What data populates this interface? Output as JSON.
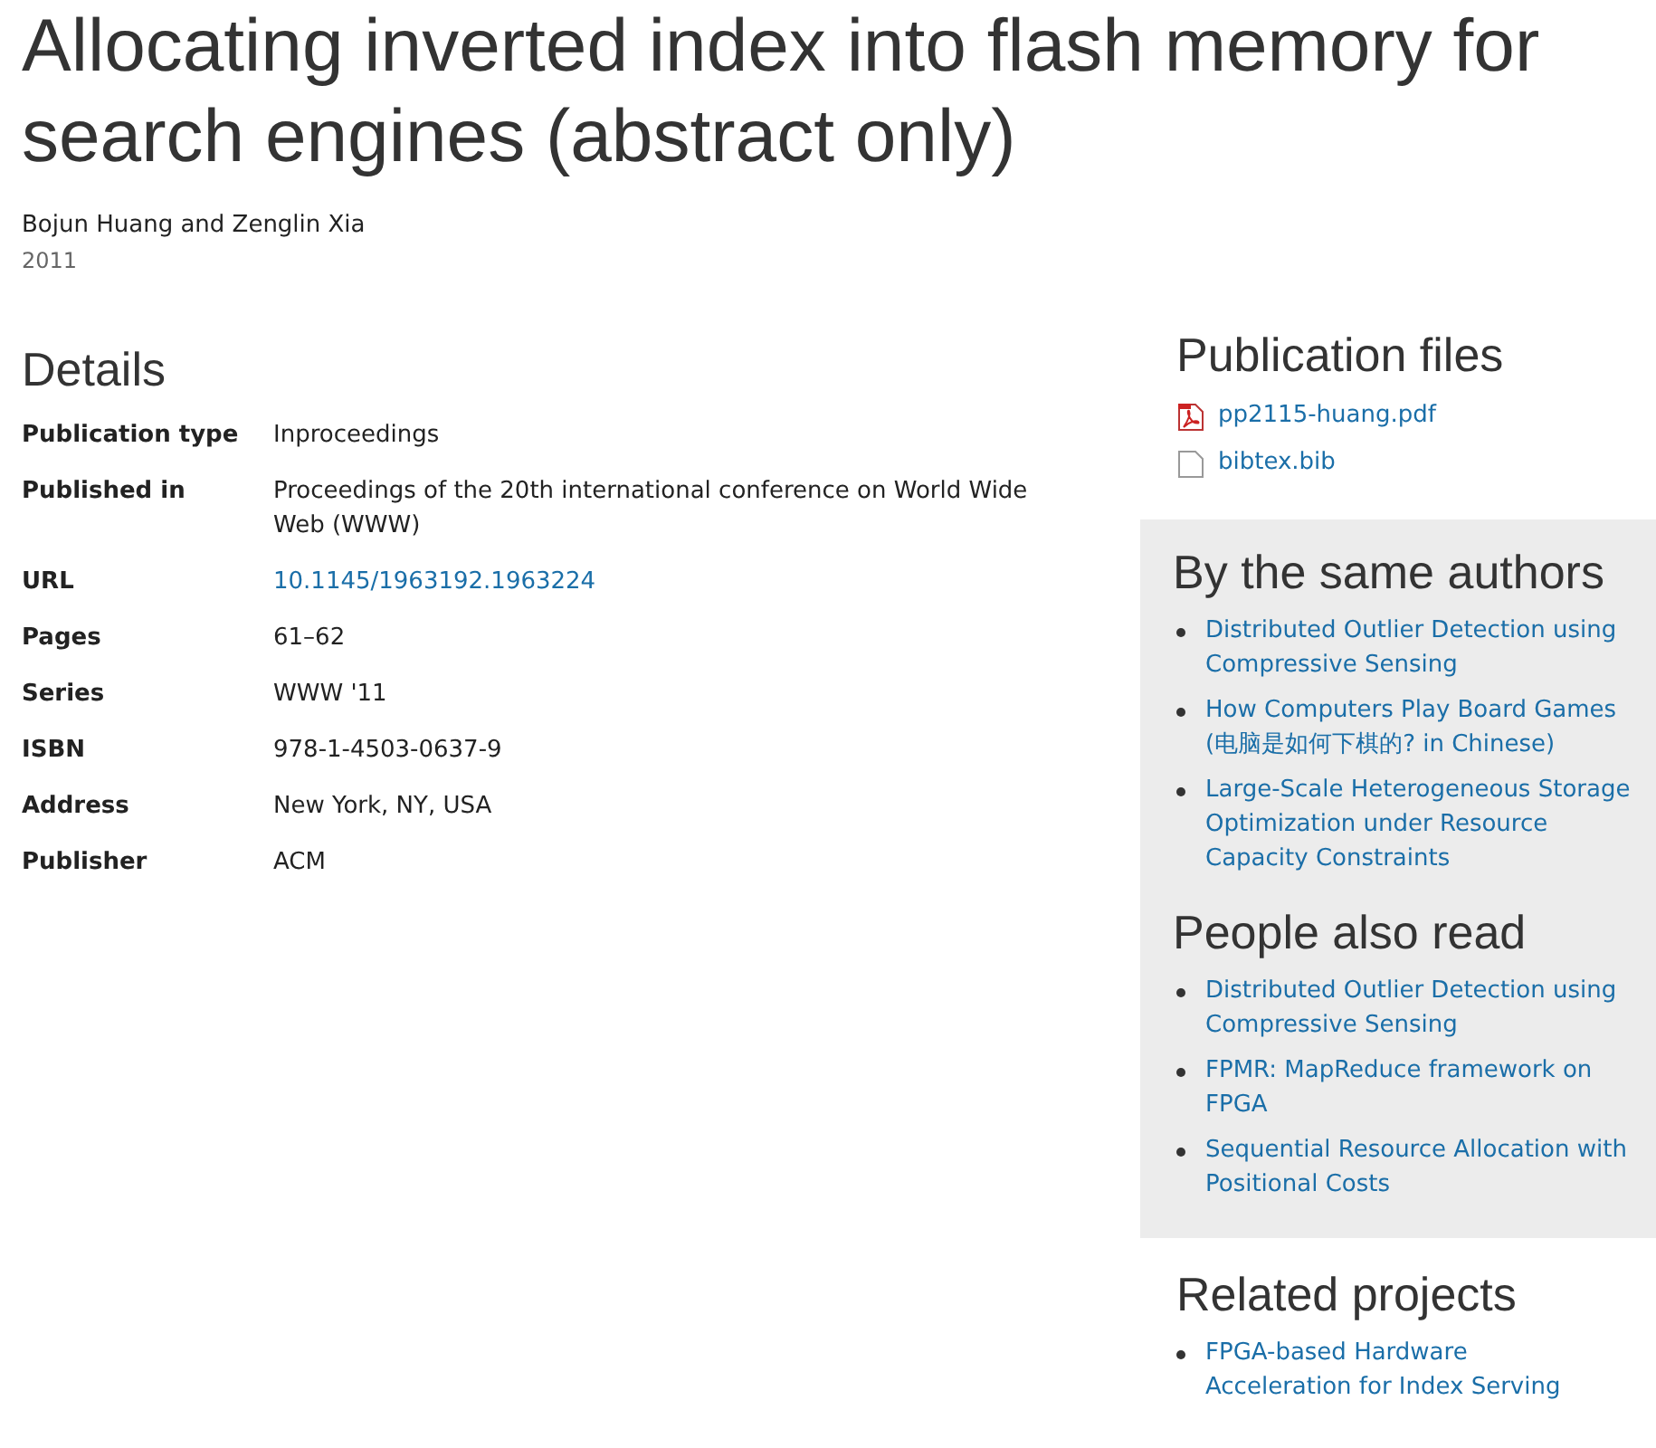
{
  "title": "Allocating inverted index into flash memory for search engines (abstract only)",
  "authors": "Bojun Huang and Zenglin Xia",
  "year": "2011",
  "details": {
    "heading": "Details",
    "rows": [
      {
        "label": "Publication type",
        "value": "Inproceedings",
        "kind": "text"
      },
      {
        "label": "Published in",
        "value": "Proceedings of the 20th international conference on World Wide Web (WWW)",
        "kind": "text"
      },
      {
        "label": "URL",
        "value": "10.1145/1963192.1963224",
        "kind": "link"
      },
      {
        "label": "Pages",
        "value": "61–62",
        "kind": "text"
      },
      {
        "label": "Series",
        "value": "WWW '11",
        "kind": "text"
      },
      {
        "label": "ISBN",
        "value": "978-1-4503-0637-9",
        "kind": "text"
      },
      {
        "label": "Address",
        "value": "New York, NY, USA",
        "kind": "text"
      },
      {
        "label": "Publisher",
        "value": "ACM",
        "kind": "text"
      }
    ]
  },
  "publication_files": {
    "heading": "Publication files",
    "files": [
      {
        "name": "pp2115-huang.pdf",
        "kind": "pdf"
      },
      {
        "name": "bibtex.bib",
        "kind": "file"
      }
    ]
  },
  "same_authors": {
    "heading": "By the same authors",
    "links": [
      "Distributed Outlier Detection using Compressive Sensing",
      "How Computers Play Board Games (电脑是如何下棋的? in Chinese)",
      "Large-Scale Heterogeneous Storage Optimization under Resource Capacity Constraints"
    ]
  },
  "people_also_read": {
    "heading": "People also read",
    "links": [
      "Distributed Outlier Detection using Compressive Sensing",
      "FPMR: MapReduce framework on FPGA",
      "Sequential Resource Allocation with Positional Costs"
    ]
  },
  "related_projects": {
    "heading": "Related projects",
    "links": [
      "FPGA-based Hardware Acceleration for Index Serving"
    ]
  }
}
